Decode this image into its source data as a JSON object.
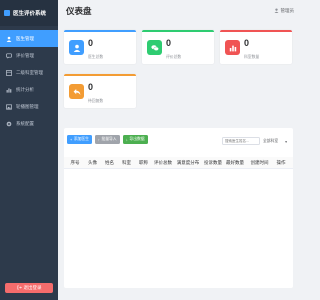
{
  "sidebar": {
    "brand": "医生评价系统",
    "items": [
      {
        "label": "医生管理",
        "icon": "doctor-icon",
        "active": true
      },
      {
        "label": "评价管理",
        "icon": "comment-icon",
        "active": false
      },
      {
        "label": "二级科室管理",
        "icon": "department-icon",
        "active": false
      },
      {
        "label": "统计分析",
        "icon": "chart-icon",
        "active": false
      },
      {
        "label": "轮播图管理",
        "icon": "image-icon",
        "active": false
      },
      {
        "label": "系统配置",
        "icon": "gear-icon",
        "active": false
      }
    ],
    "logout_label": "退出登录"
  },
  "header": {
    "title": "仪表盘",
    "user": "管理员"
  },
  "stats": [
    {
      "value": "0",
      "label": "医生总数",
      "color": "#409eff",
      "icon": "user-icon"
    },
    {
      "value": "0",
      "label": "评价总数",
      "color": "#2ecc71",
      "icon": "chat-icon"
    },
    {
      "value": "0",
      "label": "科室数量",
      "color": "#f05454",
      "icon": "bar-chart-icon"
    },
    {
      "value": "0",
      "label": "待回复数",
      "color": "#f39c34",
      "icon": "reply-icon"
    }
  ],
  "toolbar": {
    "add_label": "添加医生",
    "import_label": "批量导入",
    "export_label": "导出数据",
    "search_placeholder": "搜索医生姓名...",
    "filter_value": "全部科室"
  },
  "table": {
    "columns": [
      "序号",
      "头像",
      "姓名",
      "科室",
      "职称",
      "评价总数",
      "满意度分布",
      "投诉数量",
      "最好数量",
      "创建时间",
      "操作"
    ]
  }
}
